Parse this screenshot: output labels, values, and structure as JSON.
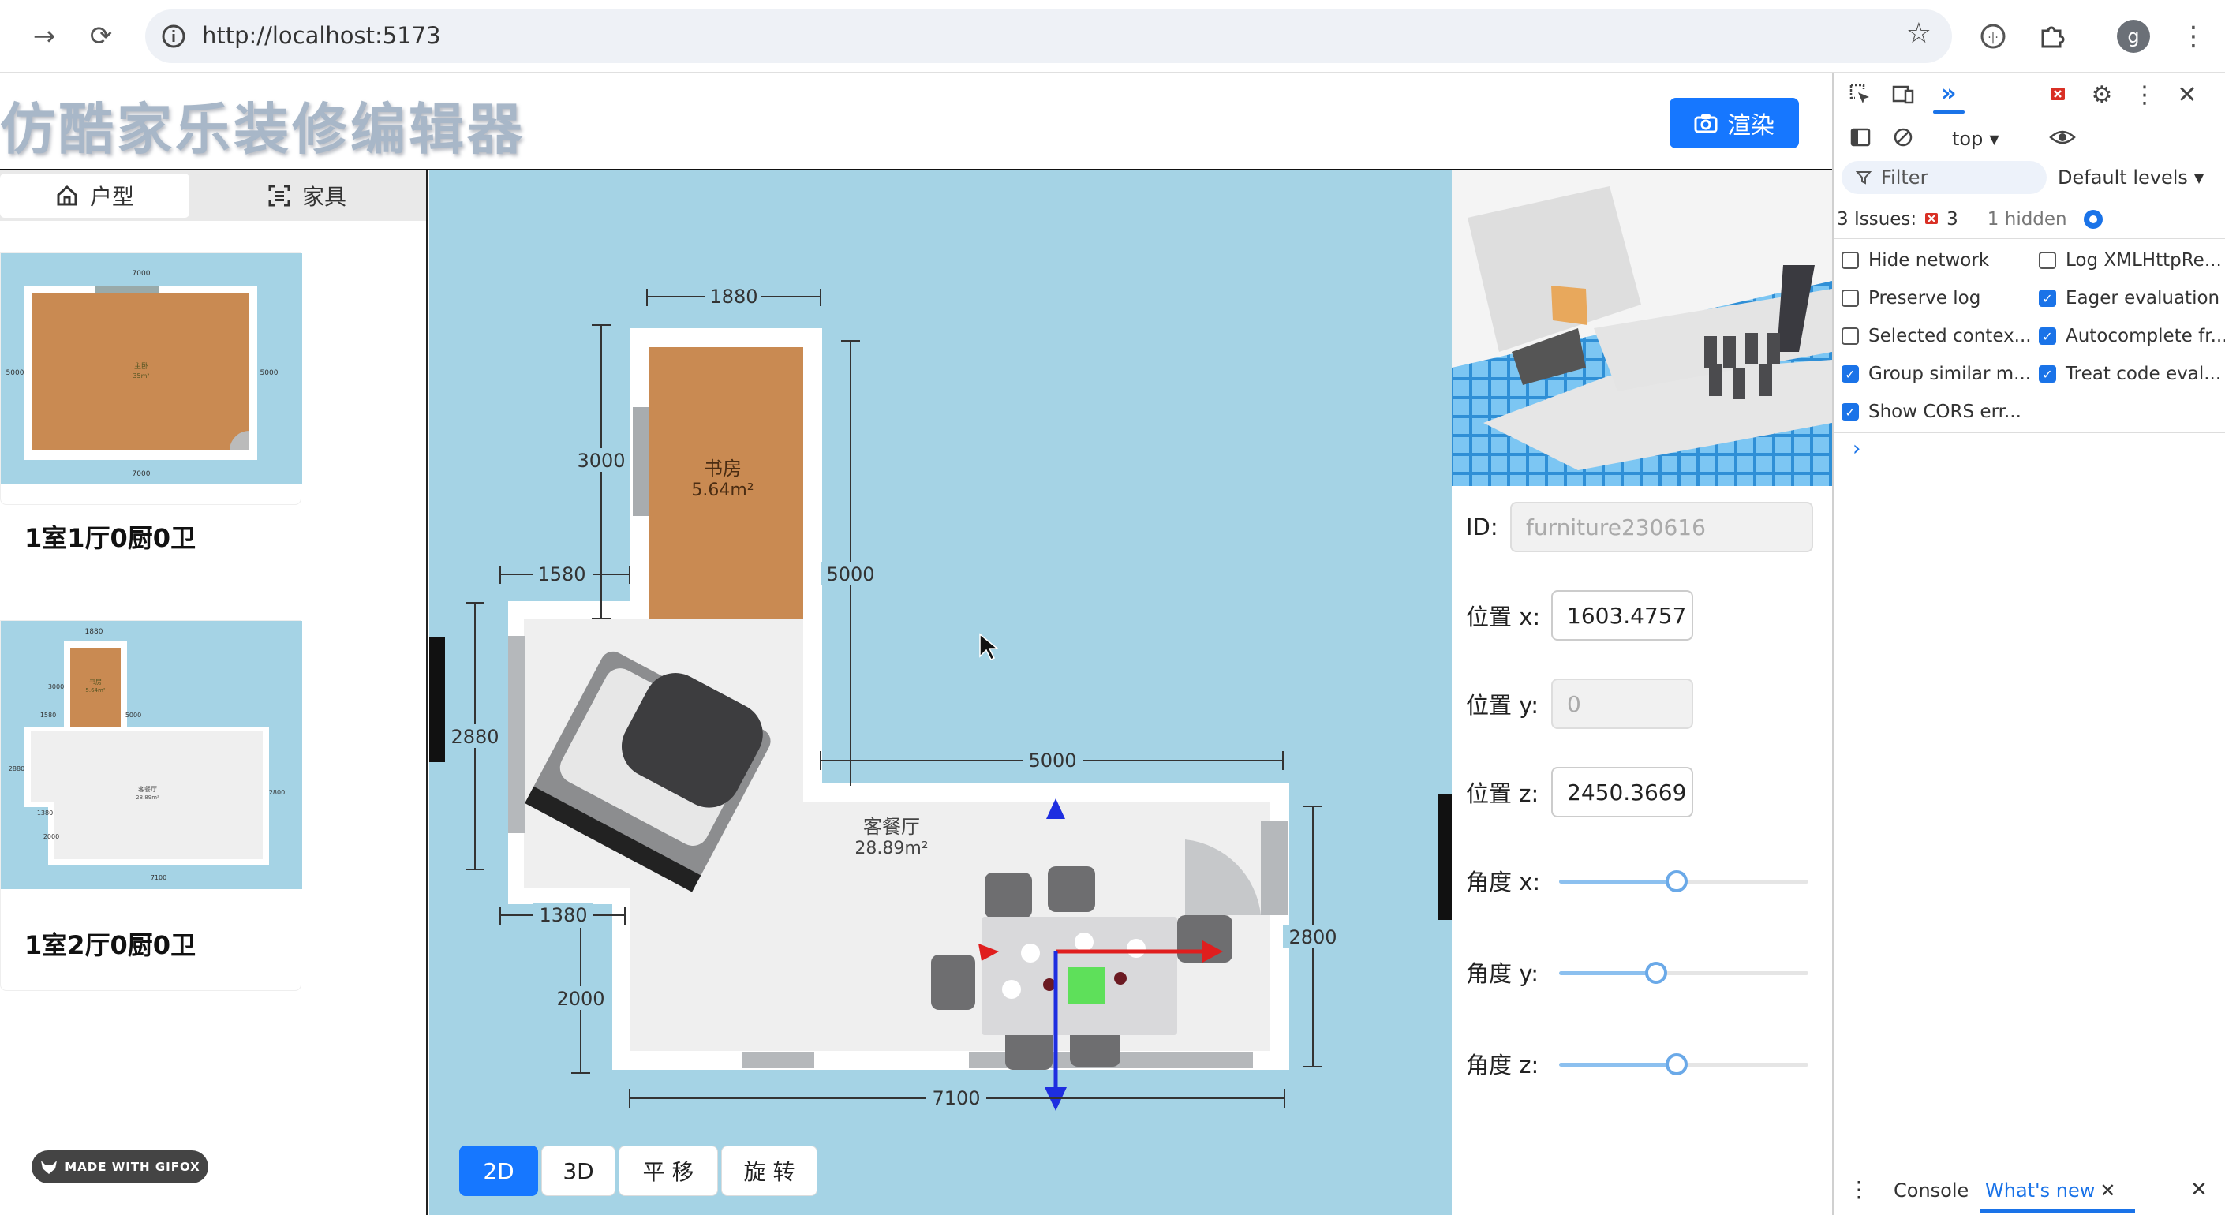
{
  "browser": {
    "url": "http://localhost:5173",
    "profile_initial": "g"
  },
  "app": {
    "title": "仿酷家乐装修编辑器",
    "render_button": "渲染"
  },
  "left_panel": {
    "tabs": [
      {
        "label": "户型",
        "icon": "home-icon",
        "active": true
      },
      {
        "label": "家具",
        "icon": "scan-icon",
        "active": false
      }
    ],
    "plans": [
      {
        "name": "1室1厅0厨0卫",
        "thumb_dims": {
          "top": "7000",
          "bottom": "7000",
          "left": "5000",
          "right": "5000"
        },
        "thumb_room": "主卧",
        "thumb_area": "35m²"
      },
      {
        "name": "1室2厅0厨0卫",
        "thumb_dims": {
          "top": "1880",
          "left": "3000",
          "d1": "1580",
          "d2": "5000",
          "d3": "2880",
          "d4": "1380",
          "d5": "2000",
          "d6": "2800",
          "bottom": "7100"
        },
        "thumb_rooms": [
          "书房",
          "5.64m²",
          "客餐厅",
          "28.89m²"
        ]
      }
    ]
  },
  "floorplan": {
    "dims": {
      "study_width": "1880",
      "study_height": "3000",
      "study_left_offset": "1580",
      "study_total_height": "5000",
      "living_top_width": "5000",
      "living_left_height": "2880",
      "living_lower_left_offset": "1380",
      "living_lower_height": "2000",
      "living_right_height": "2800",
      "bottom_width": "7100"
    },
    "rooms": [
      {
        "name": "书房",
        "area": "5.64m²"
      },
      {
        "name": "客餐厅",
        "area": "28.89m²"
      }
    ],
    "colors": {
      "background": "#a5d3e5",
      "wood": "#c98a52",
      "floor": "#efefef",
      "wall": "#ffffff",
      "gizmo_x": "#e01e1e",
      "gizmo_z": "#1e2ee0"
    }
  },
  "mode_buttons": [
    {
      "label": "2D",
      "active": true
    },
    {
      "label": "3D",
      "active": false
    },
    {
      "label": "平 移",
      "active": false
    },
    {
      "label": "旋 转",
      "active": false
    }
  ],
  "properties": {
    "id_label": "ID:",
    "id_value": "furniture230616",
    "pos_x_label": "位置 x:",
    "pos_x_value": "1603.4757",
    "pos_y_label": "位置 y:",
    "pos_y_value": "0",
    "pos_z_label": "位置 z:",
    "pos_z_value": "2450.3669",
    "angle_x_label": "角度 x:",
    "angle_x_level": 0.47,
    "angle_y_label": "角度 y:",
    "angle_y_level": 0.39,
    "angle_z_label": "角度 z:",
    "angle_z_level": 0.47
  },
  "devtools": {
    "context": "top",
    "filter_placeholder": "Filter",
    "levels": "Default levels",
    "issues_label": "3 Issues:",
    "issues_count": "3",
    "hidden": "1 hidden",
    "checks_left": [
      {
        "label": "Hide network",
        "checked": false
      },
      {
        "label": "Preserve log",
        "checked": false
      },
      {
        "label": "Selected contex...",
        "checked": false
      },
      {
        "label": "Group similar m...",
        "checked": true
      },
      {
        "label": "Show CORS err...",
        "checked": true
      }
    ],
    "checks_right": [
      {
        "label": "Log XMLHttpRe...",
        "checked": false
      },
      {
        "label": "Eager evaluation",
        "checked": true
      },
      {
        "label": "Autocomplete fr...",
        "checked": true
      },
      {
        "label": "Treat code eval...",
        "checked": true
      }
    ],
    "bottom_tabs": [
      "Console",
      "What's new"
    ]
  },
  "watermark": "MADE WITH GIFOX"
}
